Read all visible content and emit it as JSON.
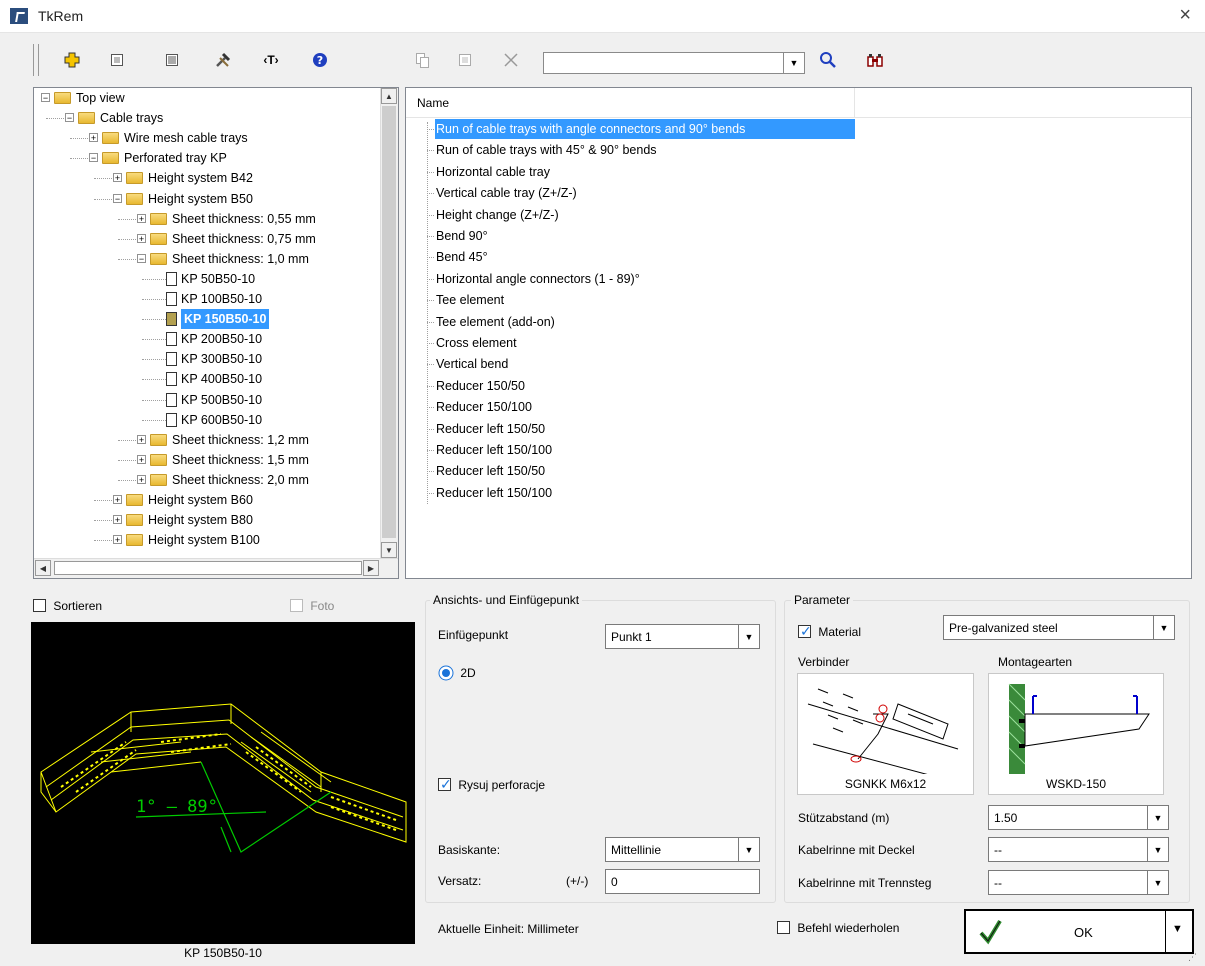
{
  "window": {
    "title": "TkRem",
    "close_glyph": "×"
  },
  "toolbar": {
    "icons": [
      "add-icon",
      "properties-icon",
      "list-icon",
      "tools-icon",
      "text-tag-icon",
      "help-icon",
      "copy-icon",
      "edit-icon",
      "delete-icon",
      "search-icon",
      "binoculars-icon"
    ],
    "text_tag_label": "‹T›",
    "search_value": ""
  },
  "tree": {
    "nodes": [
      {
        "label": "Top view",
        "level": 0,
        "type": "folder",
        "expander": "−"
      },
      {
        "label": "Cable trays",
        "level": 1,
        "type": "folder",
        "expander": "−"
      },
      {
        "label": "Wire mesh cable trays",
        "level": 2,
        "type": "folder",
        "expander": "+"
      },
      {
        "label": "Perforated tray KP",
        "level": 2,
        "type": "folder",
        "expander": "−"
      },
      {
        "label": "Height system B42",
        "level": 3,
        "type": "folder",
        "expander": "+"
      },
      {
        "label": "Height system B50",
        "level": 3,
        "type": "folder",
        "expander": "−"
      },
      {
        "label": "Sheet thickness: 0,55 mm",
        "level": 4,
        "type": "folder",
        "expander": "+"
      },
      {
        "label": "Sheet thickness: 0,75 mm",
        "level": 4,
        "type": "folder",
        "expander": "+"
      },
      {
        "label": "Sheet thickness: 1,0 mm",
        "level": 4,
        "type": "folder",
        "expander": "−"
      },
      {
        "label": "KP 50B50-10",
        "level": 5,
        "type": "doc"
      },
      {
        "label": "KP 100B50-10",
        "level": 5,
        "type": "doc"
      },
      {
        "label": "KP 150B50-10",
        "level": 5,
        "type": "doc",
        "selected": true
      },
      {
        "label": "KP 200B50-10",
        "level": 5,
        "type": "doc"
      },
      {
        "label": "KP 300B50-10",
        "level": 5,
        "type": "doc"
      },
      {
        "label": "KP 400B50-10",
        "level": 5,
        "type": "doc"
      },
      {
        "label": "KP 500B50-10",
        "level": 5,
        "type": "doc"
      },
      {
        "label": "KP 600B50-10",
        "level": 5,
        "type": "doc"
      },
      {
        "label": "Sheet thickness: 1,2 mm",
        "level": 4,
        "type": "folder",
        "expander": "+"
      },
      {
        "label": "Sheet thickness: 1,5 mm",
        "level": 4,
        "type": "folder",
        "expander": "+"
      },
      {
        "label": "Sheet thickness: 2,0 mm",
        "level": 4,
        "type": "folder",
        "expander": "+"
      },
      {
        "label": "Height system B60",
        "level": 3,
        "type": "folder",
        "expander": "+"
      },
      {
        "label": "Height system B80",
        "level": 3,
        "type": "folder",
        "expander": "+"
      },
      {
        "label": "Height system B100",
        "level": 3,
        "type": "folder",
        "expander": "+"
      }
    ]
  },
  "list": {
    "column_header": "Name",
    "items": [
      "Run of cable trays with angle connectors and 90° bends",
      "Run of cable trays with 45° & 90° bends",
      "Horizontal cable tray",
      "Vertical cable tray (Z+/Z-)",
      "Height change (Z+/Z-)",
      "Bend 90°",
      "Bend 45°",
      "Horizontal angle connectors (1 - 89)°",
      "Tee element",
      "Tee element (add-on)",
      "Cross element",
      "Vertical bend",
      "Reducer 150/50",
      "Reducer 150/100",
      "Reducer left 150/50",
      "Reducer left 150/100",
      "Reducer left 150/50",
      "Reducer left 150/100"
    ],
    "selected_index": 0
  },
  "left": {
    "sort_label": "Sortieren",
    "photo_label": "Foto",
    "preview_caption": "KP 150B50-10",
    "preview_angle_text": "1° – 89°"
  },
  "view_group": {
    "title": "Ansichts- und Einfügepunkt",
    "insert_point_label": "Einfügepunkt",
    "insert_point_value": "Punkt 1",
    "radio_2d_label": "2D",
    "draw_perforation_label": "Rysuj perforacje",
    "base_edge_label": "Basiskante:",
    "base_edge_value": "Mittellinie",
    "offset_label": "Versatz:",
    "offset_sign": "(+/-)",
    "offset_value": "0"
  },
  "param_group": {
    "title": "Parameter",
    "material_label": "Material",
    "material_value": "Pre-galvanized steel",
    "connector_label": "Verbinder",
    "mounting_label": "Montagearten",
    "connector_caption": "SGNKK M6x12",
    "mounting_caption": "WSKD-150",
    "support_distance_label": "Stützabstand (m)",
    "support_distance_value": "1.50",
    "with_cover_label": "Kabelrinne mit Deckel",
    "with_cover_value": "--",
    "with_divider_label": "Kabelrinne mit Trennsteg",
    "with_divider_value": "--"
  },
  "footer": {
    "unit_text": "Aktuelle Einheit: Millimeter",
    "repeat_label": "Befehl wiederholen",
    "ok_label": "OK"
  },
  "colors": {
    "selection": "#3399ff",
    "preview_lines": "#ffff00",
    "preview_dim": "#00cc00",
    "help_icon": "#1f3fbf",
    "add_icon": "#f5c400"
  }
}
